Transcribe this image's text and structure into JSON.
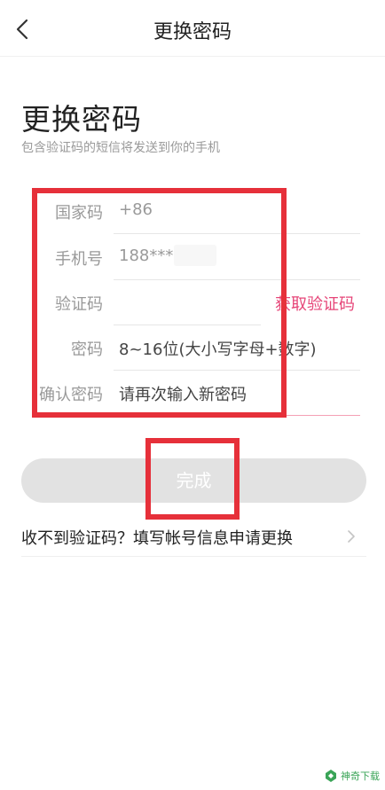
{
  "header": {
    "title": "更换密码"
  },
  "main": {
    "title": "更换密码",
    "subtitle": "包含验证码的短信将发送到你的手机",
    "form": {
      "country_code": {
        "label": "国家码",
        "value": "+86"
      },
      "phone": {
        "label": "手机号",
        "value": "188****"
      },
      "verify_code": {
        "label": "验证码",
        "value": "",
        "action": "获取验证码"
      },
      "password": {
        "label": "密码",
        "placeholder": "8~16位(大小写字母+数字)"
      },
      "confirm_password": {
        "label": "确认密码",
        "placeholder": "请再次输入新密码"
      }
    },
    "submit_label": "完成",
    "help_link": "收不到验证码？填写帐号信息申请更换"
  },
  "watermark": {
    "text": "神奇下载"
  },
  "colors": {
    "accent": "#e64578",
    "highlight_box": "#e6303a",
    "disabled_button": "#e2e2e2"
  },
  "icons": {
    "back": "chevron-left-icon",
    "help": "chevron-right-icon",
    "watermark": "logo-icon"
  }
}
